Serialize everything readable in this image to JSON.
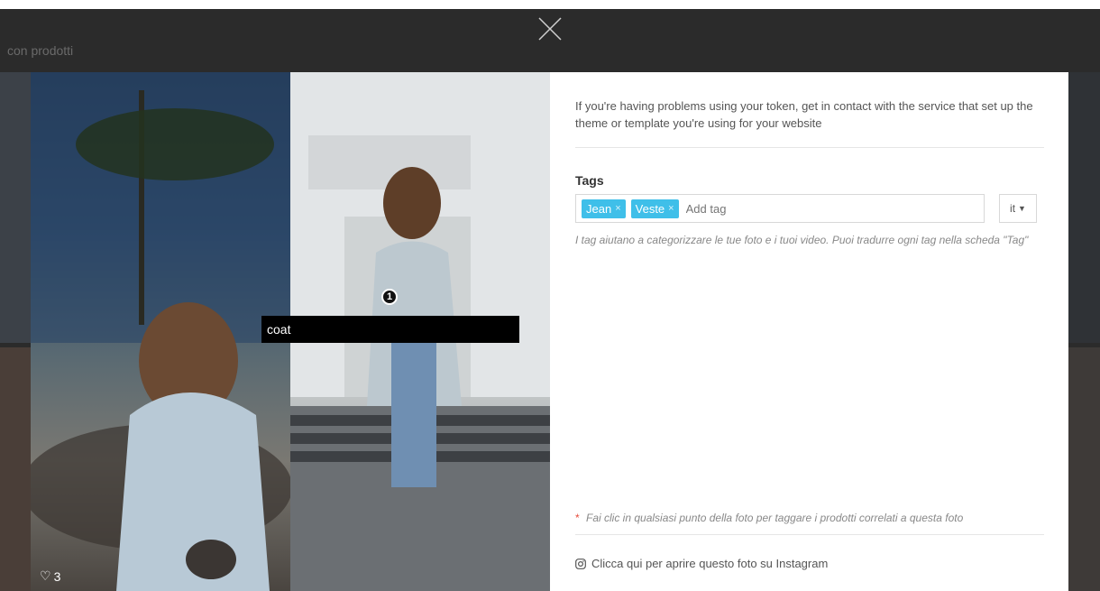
{
  "background": {
    "partial_title": "con prodotti"
  },
  "photo": {
    "likes": "3",
    "tag_marker_number": "1",
    "tag_input_value": "coat"
  },
  "panel": {
    "token_notice": "If you're having problems using your token, get in contact with the service that set up the theme or template you're using for your website",
    "tags_label": "Tags",
    "tags": [
      {
        "label": "Jean",
        "remove": "×"
      },
      {
        "label": "Veste",
        "remove": "×"
      }
    ],
    "add_tag_placeholder": "Add tag",
    "language": "it",
    "tags_help": "I tag aiutano a categorizzare le tue foto e i tuoi video. Puoi tradurre ogni tag nella scheda \"Tag\"",
    "hint_star": "*",
    "hint": "Fai clic in qualsiasi punto della foto per taggare i prodotti correlati a questa foto",
    "open_instagram": "Clicca qui per aprire questo foto su Instagram"
  },
  "icons": {
    "close": "close-icon",
    "heart": "heart-icon",
    "instagram": "instagram-icon",
    "caret": "caret-down-icon"
  },
  "colors": {
    "backdrop": "#2b2b2b",
    "chip": "#3fbfe9",
    "hint_star": "#e74c3c"
  }
}
